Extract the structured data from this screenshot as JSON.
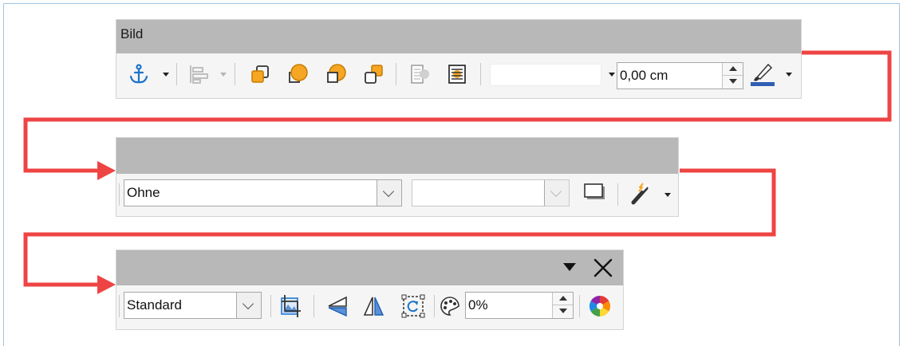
{
  "toolbar_picture": {
    "title": "Bild",
    "anchor_icon": "anchor-icon",
    "align_icon": "align-objects-icon",
    "arrange_icons": [
      "bring-to-front-icon",
      "forward-one-icon",
      "backward-one-icon",
      "send-to-back-icon"
    ],
    "wrap_icons": [
      "wrap-off-icon",
      "wrap-on-icon"
    ],
    "style_value": "",
    "line_width_value": "0,00 cm",
    "line_color_icon": "line-color-icon",
    "line_color": "#2f5fb3"
  },
  "toolbar_drawing": {
    "area_style_value": "Ohne",
    "area_fill_value": "",
    "shadow_icon": "shadow-icon",
    "fontwork_icon": "fontwork-wand-icon"
  },
  "toolbar_image": {
    "mode_value": "Standard",
    "crop_icon": "crop-image-icon",
    "flip_vertical_icon": "flip-vertical-icon",
    "flip_horizontal_icon": "flip-horizontal-icon",
    "rotate_icon": "rotate-icon",
    "transparency_icon": "transparency-icon",
    "transparency_value": "0%",
    "color_icon": "color-wheel-icon",
    "menu_icon": "toolbar-menu-icon",
    "close_icon": "close-icon"
  },
  "colors": {
    "connector": "#ef4444",
    "arrange_orange": "#f5a623",
    "titlebar": "#b8b8b8"
  }
}
